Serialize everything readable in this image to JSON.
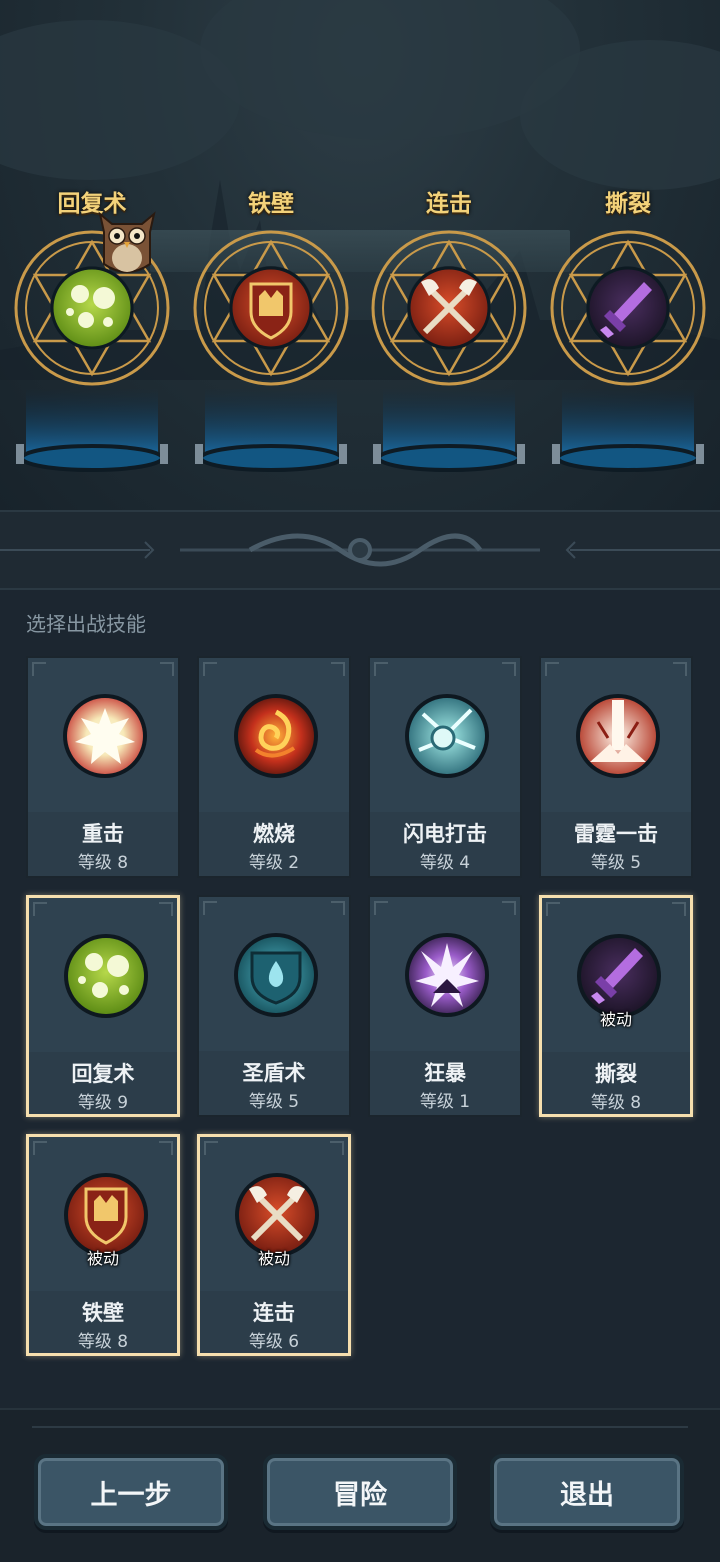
{
  "equipped": [
    {
      "name": "回复术",
      "icon": "green-orb-icon"
    },
    {
      "name": "铁壁",
      "icon": "iron-wall-shield-icon"
    },
    {
      "name": "连击",
      "icon": "crossed-axes-icon"
    },
    {
      "name": "撕裂",
      "icon": "purple-sword-icon"
    }
  ],
  "section_title": "选择出战技能",
  "skills": [
    {
      "name": "重击",
      "level": "等级 8",
      "icon": "heavy-strike-icon",
      "selected": false,
      "passive": ""
    },
    {
      "name": "燃烧",
      "level": "等级 2",
      "icon": "burn-icon",
      "selected": false,
      "passive": ""
    },
    {
      "name": "闪电打击",
      "level": "等级 4",
      "icon": "lightning-strike-icon",
      "selected": false,
      "passive": ""
    },
    {
      "name": "雷霆一击",
      "level": "等级 5",
      "icon": "thunder-strike-icon",
      "selected": false,
      "passive": ""
    },
    {
      "name": "回复术",
      "level": "等级 9",
      "icon": "green-orb-icon",
      "selected": true,
      "passive": ""
    },
    {
      "name": "圣盾术",
      "level": "等级 5",
      "icon": "holy-shield-icon",
      "selected": false,
      "passive": ""
    },
    {
      "name": "狂暴",
      "level": "等级 1",
      "icon": "berserk-icon",
      "selected": false,
      "passive": ""
    },
    {
      "name": "撕裂",
      "level": "等级 8",
      "icon": "purple-sword-icon",
      "selected": true,
      "passive": "被动"
    },
    {
      "name": "铁壁",
      "level": "等级 8",
      "icon": "iron-wall-shield-icon",
      "selected": true,
      "passive": "被动"
    },
    {
      "name": "连击",
      "level": "等级 6",
      "icon": "crossed-axes-icon",
      "selected": true,
      "passive": "被动"
    }
  ],
  "buttons": {
    "prev": "上一步",
    "adventure": "冒险",
    "exit": "退出"
  }
}
